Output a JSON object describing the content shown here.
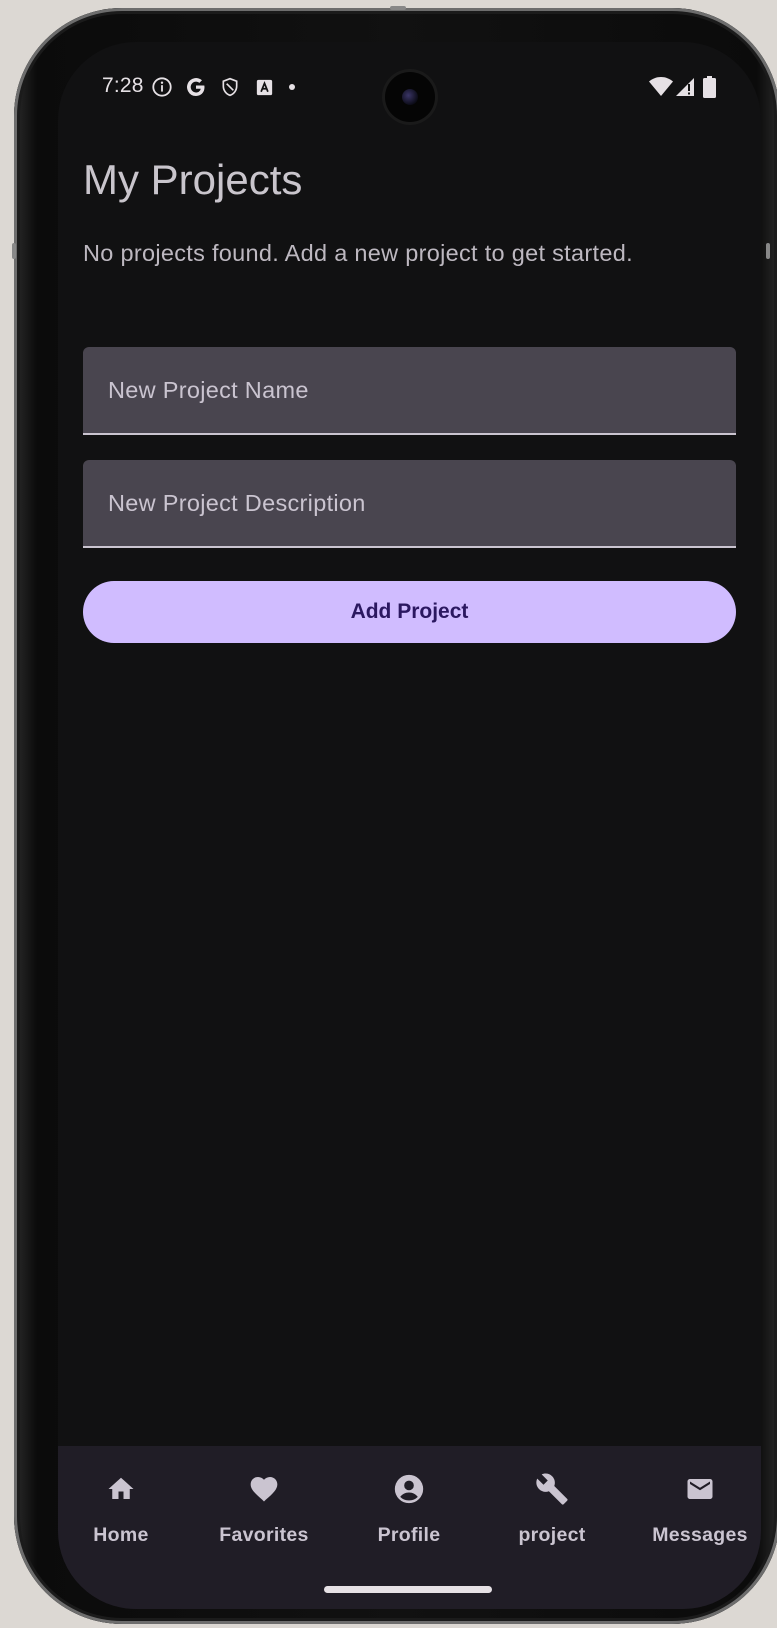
{
  "status_bar": {
    "time": "7:28",
    "icons": [
      "info-icon",
      "google-icon",
      "shield-icon",
      "font-icon",
      "dot-icon",
      "wifi-icon",
      "signal-icon",
      "battery-icon"
    ]
  },
  "page": {
    "title": "My Projects",
    "empty_message": "No projects found. Add a new project to get started."
  },
  "form": {
    "name_placeholder": "New Project Name",
    "description_placeholder": "New Project Description",
    "add_button_label": "Add Project"
  },
  "bottom_nav": {
    "items": [
      {
        "label": "Home",
        "icon": "home-icon"
      },
      {
        "label": "Favorites",
        "icon": "heart-icon"
      },
      {
        "label": "Profile",
        "icon": "account-circle-icon"
      },
      {
        "label": "project",
        "icon": "wrench-icon"
      },
      {
        "label": "Messages",
        "icon": "mail-icon"
      }
    ]
  },
  "colors": {
    "background": "#111112",
    "text_field": "#49454f",
    "accent_button": "#d0bcff",
    "nav_bar": "#201d26"
  }
}
